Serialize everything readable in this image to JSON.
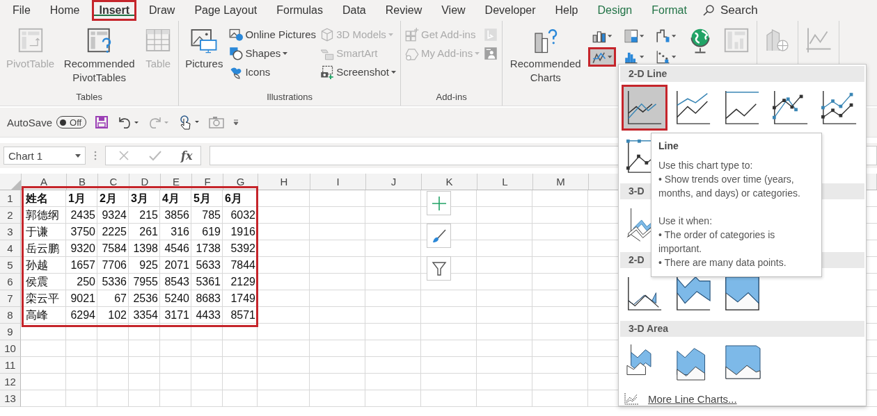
{
  "ribbon_tabs": [
    {
      "label": "File",
      "selected": false,
      "kind": "plain"
    },
    {
      "label": "Home",
      "selected": false,
      "kind": "plain"
    },
    {
      "label": "Insert",
      "selected": true,
      "kind": "plain"
    },
    {
      "label": "Draw",
      "selected": false,
      "kind": "plain"
    },
    {
      "label": "Page Layout",
      "selected": false,
      "kind": "plain"
    },
    {
      "label": "Formulas",
      "selected": false,
      "kind": "plain"
    },
    {
      "label": "Data",
      "selected": false,
      "kind": "plain"
    },
    {
      "label": "Review",
      "selected": false,
      "kind": "plain"
    },
    {
      "label": "View",
      "selected": false,
      "kind": "plain"
    },
    {
      "label": "Developer",
      "selected": false,
      "kind": "plain"
    },
    {
      "label": "Help",
      "selected": false,
      "kind": "plain"
    },
    {
      "label": "Design",
      "selected": false,
      "kind": "contextual"
    },
    {
      "label": "Format",
      "selected": false,
      "kind": "contextual"
    }
  ],
  "search": {
    "label": "Search"
  },
  "ribbon_groups": [
    {
      "label": "Tables",
      "items": [
        {
          "kind": "large",
          "label": "PivotTable",
          "disabled": true
        },
        {
          "kind": "large",
          "label": "Recommended PivotTables",
          "disabled": false
        },
        {
          "kind": "large",
          "label": "Table",
          "disabled": true
        }
      ]
    },
    {
      "label": "Illustrations",
      "items": [
        {
          "kind": "large",
          "label": "Pictures",
          "disabled": false
        },
        {
          "kind": "stack",
          "items": [
            {
              "label": "Online Pictures",
              "disabled": false,
              "dropdown": false
            },
            {
              "label": "Shapes",
              "disabled": false,
              "dropdown": true
            },
            {
              "label": "Icons",
              "disabled": false,
              "dropdown": false
            }
          ]
        },
        {
          "kind": "stack",
          "items": [
            {
              "label": "3D Models",
              "disabled": true,
              "dropdown": true
            },
            {
              "label": "SmartArt",
              "disabled": true,
              "dropdown": false
            },
            {
              "label": "Screenshot",
              "disabled": false,
              "dropdown": true
            }
          ]
        }
      ]
    },
    {
      "label": "Add-ins",
      "items": [
        {
          "kind": "stack",
          "items": [
            {
              "label": "Get Add-ins",
              "disabled": true,
              "dropdown": false
            },
            {
              "label": "My Add-ins",
              "disabled": true,
              "dropdown": true
            }
          ]
        },
        {
          "kind": "stack",
          "items": [
            {
              "disabled": true
            },
            {
              "disabled": true
            }
          ]
        }
      ]
    },
    {
      "items": [
        {
          "kind": "large",
          "label": "Recommended Charts",
          "disabled": false
        },
        {
          "kind": "chart_grid",
          "buttons": [
            {
              "selected": false
            },
            {
              "selected": false
            },
            {
              "selected": false
            },
            {
              "selected": true
            },
            {
              "selected": false
            },
            {
              "selected": false
            }
          ]
        },
        {
          "kind": "large",
          "disabled": false
        },
        {
          "kind": "large",
          "disabled": true
        }
      ]
    },
    {
      "items": [
        {
          "kind": "large",
          "disabled": true
        }
      ]
    },
    {
      "items": [
        {
          "kind": "large",
          "disabled": true
        }
      ]
    }
  ],
  "quick_access": {
    "autosave": {
      "label": "AutoSave",
      "state": "Off",
      "on": false
    }
  },
  "name_box": {
    "value": "Chart 1"
  },
  "formula_bar": {
    "function_label": "fx"
  },
  "sheet": {
    "columns": [
      "A",
      "B",
      "C",
      "D",
      "E",
      "F",
      "G",
      "H",
      "I",
      "J",
      "K",
      "L",
      "M"
    ],
    "row_numbers": [
      "1",
      "2",
      "3",
      "4",
      "5",
      "6",
      "7",
      "8",
      "9",
      "10",
      "11",
      "12",
      "13"
    ],
    "highlight": true,
    "header": [
      "姓名",
      "1月",
      "2月",
      "3月",
      "4月",
      "5月",
      "6月"
    ],
    "rows": [
      [
        "郭德纲",
        "2435",
        "9324",
        "215",
        "3856",
        "785",
        "6032"
      ],
      [
        "于谦",
        "3750",
        "2225",
        "261",
        "316",
        "619",
        "1916"
      ],
      [
        "岳云鹏",
        "9320",
        "7584",
        "1398",
        "4546",
        "1738",
        "5392"
      ],
      [
        "孙越",
        "1657",
        "7706",
        "925",
        "2071",
        "5633",
        "7844"
      ],
      [
        "侯震",
        "250",
        "5336",
        "7955",
        "8543",
        "5361",
        "2129"
      ],
      [
        "栾云平",
        "9021",
        "67",
        "2536",
        "5240",
        "8683",
        "1749"
      ],
      [
        "高峰",
        "6294",
        "102",
        "3354",
        "3171",
        "4433",
        "8571"
      ]
    ]
  },
  "chart_menu": {
    "sections": [
      {
        "title": "2-D Line",
        "items": [
          {
            "kind": "line",
            "selected": true
          },
          {
            "kind": "stacked-line",
            "selected": false
          },
          {
            "kind": "full-line",
            "selected": false
          },
          {
            "kind": "line-markers",
            "selected": false
          },
          {
            "kind": "stacked-markers",
            "selected": false
          },
          {
            "kind": "full-markers",
            "selected": false
          }
        ]
      },
      {
        "title": "3-D",
        "items": [
          {
            "kind": "line-3d",
            "selected": false
          }
        ]
      },
      {
        "title": "2-D",
        "items": [
          {
            "kind": "area",
            "selected": false
          },
          {
            "kind": "stacked-area",
            "selected": false
          },
          {
            "kind": "full-area",
            "selected": false
          }
        ]
      },
      {
        "title": "3-D Area",
        "items": [
          {
            "kind": "area-3d",
            "selected": false
          },
          {
            "kind": "stacked-area-3d",
            "selected": false
          },
          {
            "kind": "full-area-3d",
            "selected": false
          }
        ]
      }
    ],
    "more": {
      "label": "More Line Charts..."
    },
    "tooltip": {
      "title": "Line",
      "lines": [
        "Use this chart type to:",
        "• Show trends over time (years, months, and days) or categories.",
        "Use it when:",
        "• The order of categories is important.",
        "• There are many data points."
      ]
    }
  }
}
